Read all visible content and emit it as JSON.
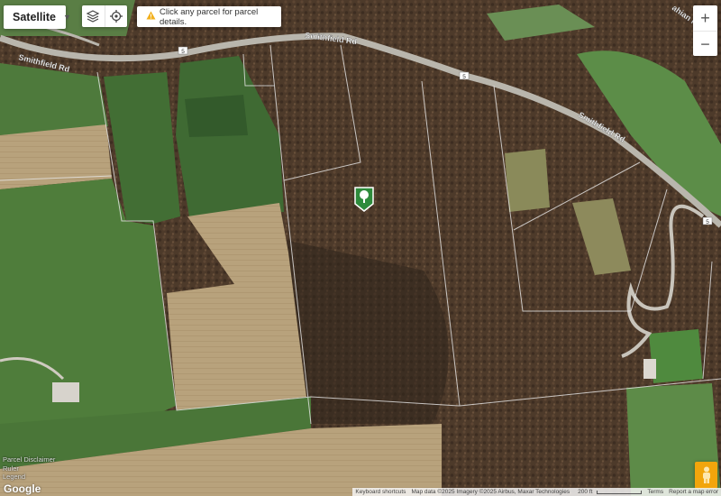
{
  "toolbar": {
    "map_type_label": "Satellite",
    "hint_text": "Click any parcel for parcel details."
  },
  "road": {
    "name": "Smithfield Rd",
    "shield": "5",
    "partial_label": "ahian Rd"
  },
  "overlay_links": {
    "disclaimer": "Parcel Disclaimer",
    "ruler": "Ruler",
    "legend": "Legend"
  },
  "attribution": {
    "shortcuts": "Keyboard shortcuts",
    "map_data": "Map data ©2025 Imagery ©2025 Airbus, Maxar Technologies",
    "scale": "200 ft",
    "terms": "Terms",
    "report": "Report a map error"
  },
  "logo": "Google",
  "zoom": {
    "in": "+",
    "out": "−"
  },
  "icons": {
    "map_type_caret": "caret-down-icon",
    "layers": "layers-icon",
    "locate": "target-icon",
    "warning": "warning-icon",
    "parcel_marker": "tree-marker-icon",
    "pegman": "pegman-icon"
  },
  "colors": {
    "forest": "#4e3b2a",
    "field_green": "#4f7a3e",
    "field_tan": "#b8a27c",
    "road": "#b9b6ad",
    "parcel_line": "#e8e8e8",
    "marker": "#2e8b3c"
  }
}
